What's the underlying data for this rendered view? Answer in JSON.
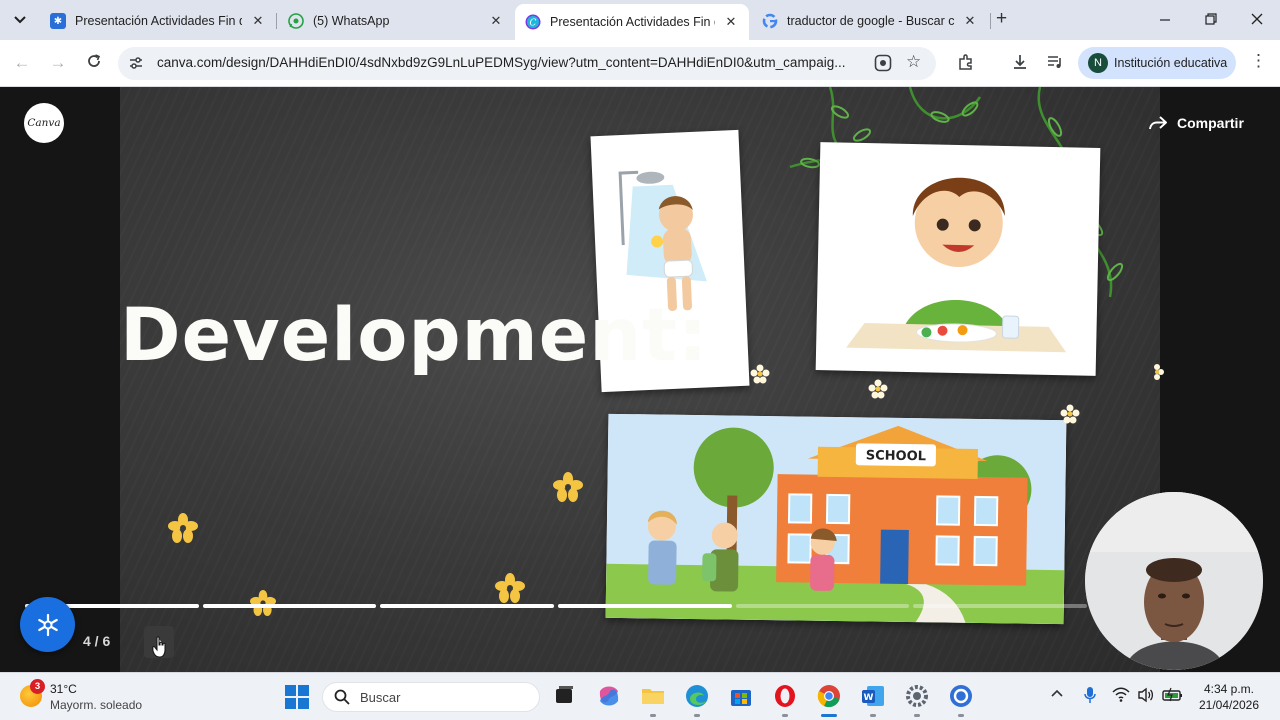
{
  "browser": {
    "tabs": [
      {
        "title": "Presentación Actividades Fin de",
        "favicon": "canva-settings-icon",
        "active": false
      },
      {
        "title": "(5) WhatsApp",
        "favicon": "whatsapp-icon",
        "active": false
      },
      {
        "title": "Presentación Actividades Fin de",
        "favicon": "canva-icon",
        "active": true
      },
      {
        "title": "traductor de google - Buscar c",
        "favicon": "google-icon",
        "active": false
      }
    ],
    "url": "canva.com/design/DAHHdiEnDI0/4sdNxbd9zG9LnLuPEDMSyg/view?utm_content=DAHHdiEnDI0&utm_campaig...",
    "profile": {
      "initial": "N",
      "name": "Institución educativa"
    }
  },
  "presentation": {
    "logo_text": "Canva",
    "share_label": "Compartir",
    "slide_title": "Development:",
    "school_sign": "SCHOOL",
    "page_indicator": "4 / 6",
    "current_page": 4,
    "total_pages": 6,
    "next_symbol": "›"
  },
  "taskbar": {
    "weather": {
      "badge": "3",
      "temperature": "31°C",
      "condition": "Mayorm. soleado"
    },
    "search_placeholder": "Buscar",
    "time": "4:34 p.m.",
    "date": "21/04/2026"
  },
  "colors": {
    "chalkboard": "#3a3a3a",
    "accent_blue": "#1a6fe0",
    "flower_yellow": "#f4c542"
  }
}
